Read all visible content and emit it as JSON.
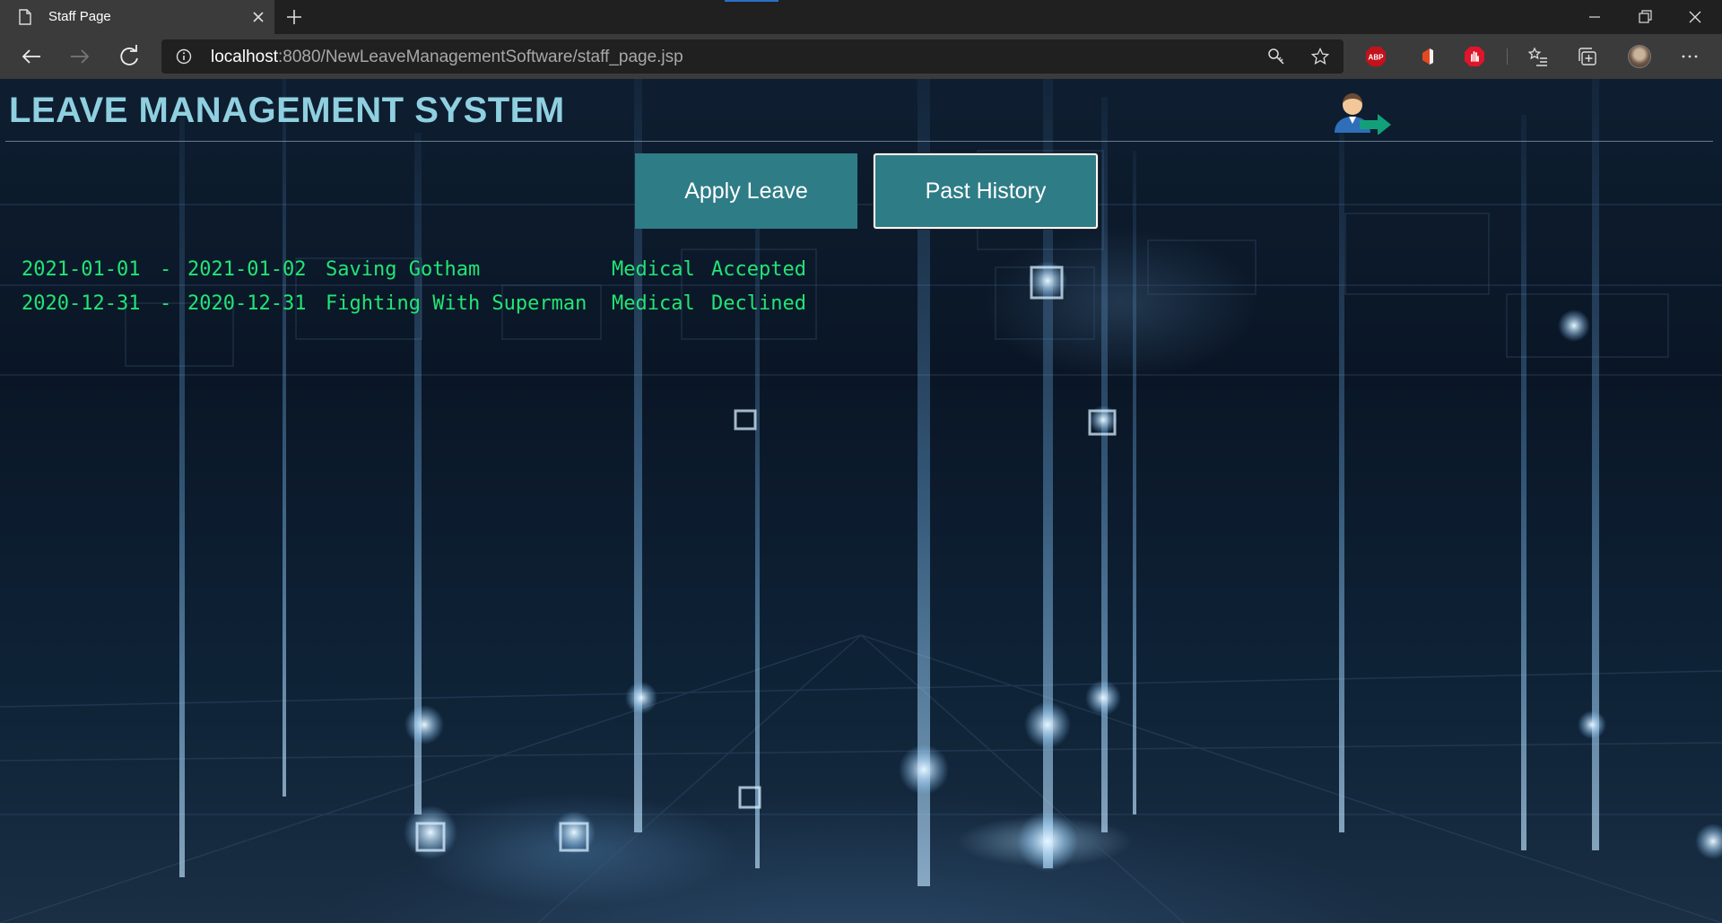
{
  "browser": {
    "tab_title": "Staff Page",
    "url_host": "localhost",
    "url_path": ":8080/NewLeaveManagementSoftware/staff_page.jsp",
    "extensions": [
      "adblock-plus-icon",
      "ms-extension-icon",
      "stop-hand-icon"
    ]
  },
  "page": {
    "title": "LEAVE MANAGEMENT SYSTEM",
    "accent_color": "#2e7c86",
    "title_color": "#8fd0e0",
    "record_color": "#21e575"
  },
  "actions": {
    "apply_leave": "Apply Leave",
    "past_history": "Past History"
  },
  "leave_records": [
    {
      "start": "2021-01-01",
      "sep": "-",
      "end": "2021-01-02",
      "reason": "Saving Gotham",
      "type": "Medical",
      "status": "Accepted"
    },
    {
      "start": "2020-12-31",
      "sep": "-",
      "end": "2020-12-31",
      "reason": "Fighting With Superman",
      "type": "Medical",
      "status": "Declined"
    }
  ]
}
